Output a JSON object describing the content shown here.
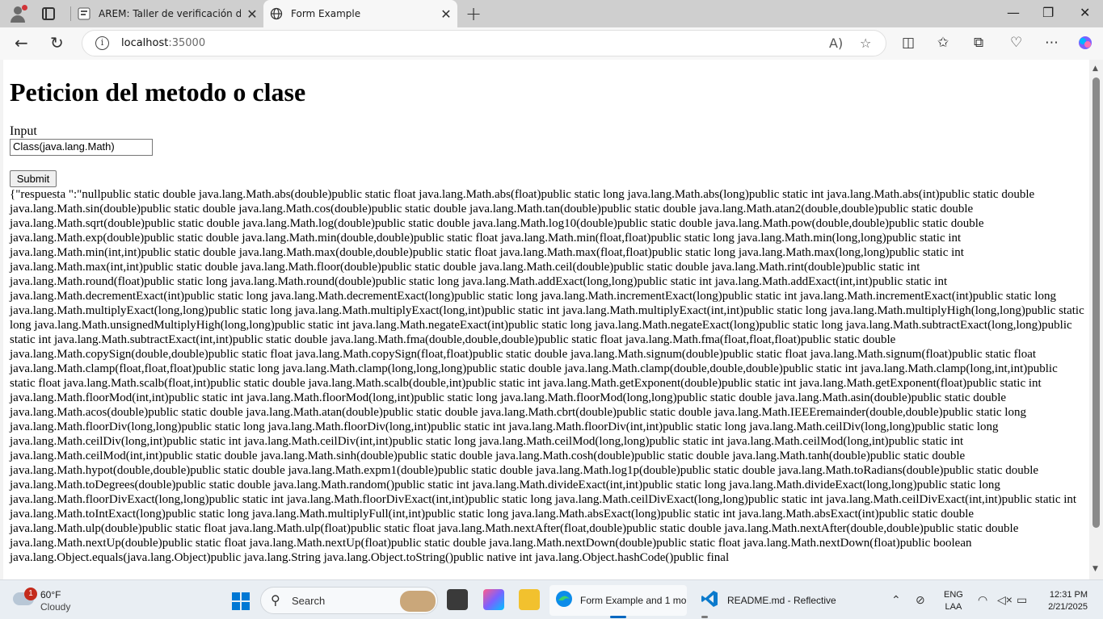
{
  "browser": {
    "tabs": [
      {
        "title": "AREM: Taller de verificación de co",
        "active": false
      },
      {
        "title": "Form Example",
        "active": true
      }
    ],
    "new_tab": "+",
    "url_host": "localhost",
    "url_port": ":35000"
  },
  "page": {
    "heading": "Peticion del metodo o clase",
    "input_label": "Input",
    "input_value": "Class(java.lang.Math)",
    "submit_label": "Submit",
    "response": "{\"respuesta \":\"nullpublic static double java.lang.Math.abs(double)public static float java.lang.Math.abs(float)public static long java.lang.Math.abs(long)public static int java.lang.Math.abs(int)public static double java.lang.Math.sin(double)public static double java.lang.Math.cos(double)public static double java.lang.Math.tan(double)public static double java.lang.Math.atan2(double,double)public static double java.lang.Math.sqrt(double)public static double java.lang.Math.log(double)public static double java.lang.Math.log10(double)public static double java.lang.Math.pow(double,double)public static double java.lang.Math.exp(double)public static double java.lang.Math.min(double,double)public static float java.lang.Math.min(float,float)public static long java.lang.Math.min(long,long)public static int java.lang.Math.min(int,int)public static double java.lang.Math.max(double,double)public static float java.lang.Math.max(float,float)public static long java.lang.Math.max(long,long)public static int java.lang.Math.max(int,int)public static double java.lang.Math.floor(double)public static double java.lang.Math.ceil(double)public static double java.lang.Math.rint(double)public static int java.lang.Math.round(float)public static long java.lang.Math.round(double)public static long java.lang.Math.addExact(long,long)public static int java.lang.Math.addExact(int,int)public static int java.lang.Math.decrementExact(int)public static long java.lang.Math.decrementExact(long)public static long java.lang.Math.incrementExact(long)public static int java.lang.Math.incrementExact(int)public static long java.lang.Math.multiplyExact(long,long)public static long java.lang.Math.multiplyExact(long,int)public static int java.lang.Math.multiplyExact(int,int)public static long java.lang.Math.multiplyHigh(long,long)public static long java.lang.Math.unsignedMultiplyHigh(long,long)public static int java.lang.Math.negateExact(int)public static long java.lang.Math.negateExact(long)public static long java.lang.Math.subtractExact(long,long)public static int java.lang.Math.subtractExact(int,int)public static double java.lang.Math.fma(double,double,double)public static float java.lang.Math.fma(float,float,float)public static double java.lang.Math.copySign(double,double)public static float java.lang.Math.copySign(float,float)public static double java.lang.Math.signum(double)public static float java.lang.Math.signum(float)public static float java.lang.Math.clamp(float,float,float)public static long java.lang.Math.clamp(long,long,long)public static double java.lang.Math.clamp(double,double,double)public static int java.lang.Math.clamp(long,int,int)public static float java.lang.Math.scalb(float,int)public static double java.lang.Math.scalb(double,int)public static int java.lang.Math.getExponent(double)public static int java.lang.Math.getExponent(float)public static int java.lang.Math.floorMod(int,int)public static int java.lang.Math.floorMod(long,int)public static long java.lang.Math.floorMod(long,long)public static double java.lang.Math.asin(double)public static double java.lang.Math.acos(double)public static double java.lang.Math.atan(double)public static double java.lang.Math.cbrt(double)public static double java.lang.Math.IEEEremainder(double,double)public static long java.lang.Math.floorDiv(long,long)public static long java.lang.Math.floorDiv(long,int)public static int java.lang.Math.floorDiv(int,int)public static long java.lang.Math.ceilDiv(long,long)public static long java.lang.Math.ceilDiv(long,int)public static int java.lang.Math.ceilDiv(int,int)public static long java.lang.Math.ceilMod(long,long)public static int java.lang.Math.ceilMod(long,int)public static int java.lang.Math.ceilMod(int,int)public static double java.lang.Math.sinh(double)public static double java.lang.Math.cosh(double)public static double java.lang.Math.tanh(double)public static double java.lang.Math.hypot(double,double)public static double java.lang.Math.expm1(double)public static double java.lang.Math.log1p(double)public static double java.lang.Math.toRadians(double)public static double java.lang.Math.toDegrees(double)public static double java.lang.Math.random()public static int java.lang.Math.divideExact(int,int)public static long java.lang.Math.divideExact(long,long)public static long java.lang.Math.floorDivExact(long,long)public static int java.lang.Math.floorDivExact(int,int)public static long java.lang.Math.ceilDivExact(long,long)public static int java.lang.Math.ceilDivExact(int,int)public static int java.lang.Math.toIntExact(long)public static long java.lang.Math.multiplyFull(int,int)public static long java.lang.Math.absExact(long)public static int java.lang.Math.absExact(int)public static double java.lang.Math.ulp(double)public static float java.lang.Math.ulp(float)public static float java.lang.Math.nextAfter(float,double)public static double java.lang.Math.nextAfter(double,double)public static double java.lang.Math.nextUp(double)public static float java.lang.Math.nextUp(float)public static double java.lang.Math.nextDown(double)public static float java.lang.Math.nextDown(float)public boolean java.lang.Object.equals(java.lang.Object)public java.lang.String java.lang.Object.toString()public native int java.lang.Object.hashCode()public final"
  },
  "taskbar": {
    "weather_badge": "1",
    "weather_temp": "60°F",
    "weather_desc": "Cloudy",
    "search_placeholder": "Search",
    "task_edge": "Form Example and 1 mo",
    "task_vscode": "README.md - Reflective",
    "lang_line1": "ENG",
    "lang_line2": "LAA",
    "time": "12:31 PM",
    "date": "2/21/2025"
  },
  "colors": {
    "accent": "#0078d4",
    "tab_strip": "#cfcfcf",
    "toolbar": "#f7f7f7"
  }
}
